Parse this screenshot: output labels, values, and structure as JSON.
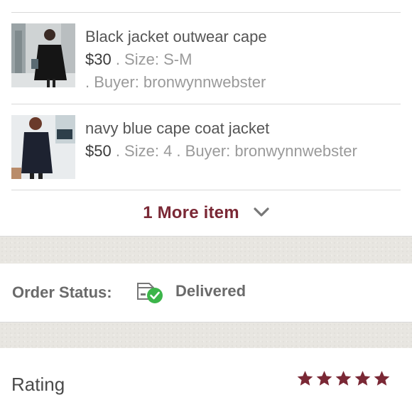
{
  "items": [
    {
      "title": "Black jacket outwear cape",
      "price": "$30",
      "size_text": " . Size: S-M",
      "buyer_text": " . Buyer: bronwynnwebster"
    },
    {
      "title": "navy blue cape coat jacket",
      "price": "$50",
      "details_text": " . Size: 4 . Buyer: bronwynnwebster"
    }
  ],
  "more_items": {
    "label": "1 More item",
    "icon": "chevron-down-icon"
  },
  "order_status": {
    "label": "Order Status:",
    "value": "Delivered",
    "icon": "package-delivered-icon"
  },
  "rating": {
    "label": "Rating",
    "stars": 5
  },
  "colors": {
    "accent": "#7a2835",
    "check_green": "#3cb54a",
    "background_texture": "#e8e6e1"
  }
}
